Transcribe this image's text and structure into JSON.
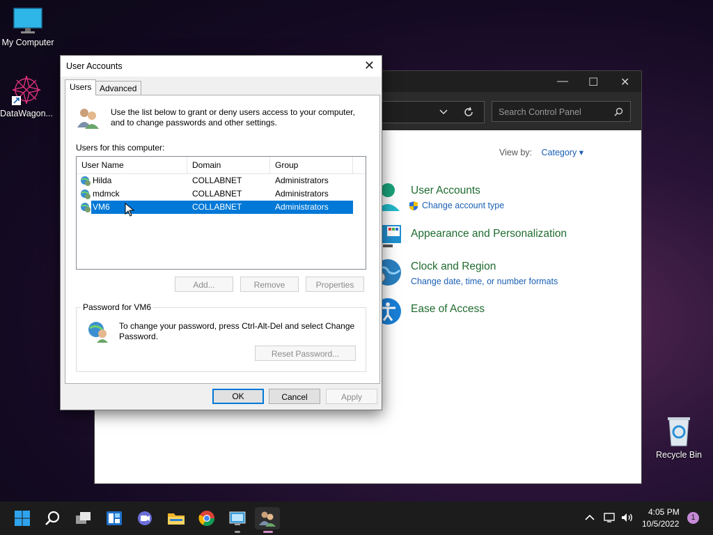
{
  "desktop": {
    "icons": [
      {
        "label": "My Computer"
      },
      {
        "label": "DataWagon..."
      },
      {
        "label": "Recycle Bin"
      }
    ]
  },
  "control_panel": {
    "window_controls": {
      "minimize": "—",
      "maximize": "☐",
      "close": "✕"
    },
    "search_placeholder": "Search Control Panel",
    "view_by_label": "View by:",
    "view_by_value": "Category",
    "categories": [
      {
        "title": "User Accounts",
        "link": "Change account type"
      },
      {
        "title": "Appearance and Personalization",
        "link": ""
      },
      {
        "title": "Clock and Region",
        "link": "Change date, time, or number formats"
      },
      {
        "title": "Ease of Access",
        "link": ""
      }
    ]
  },
  "dialog": {
    "title": "User Accounts",
    "close": "✕",
    "tabs": [
      "Users",
      "Advanced"
    ],
    "intro": "Use the list below to grant or deny users access to your computer, and to change passwords and other settings.",
    "users_label": "Users for this computer:",
    "columns": [
      "User Name",
      "Domain",
      "Group"
    ],
    "rows": [
      {
        "name": "Hilda",
        "domain": "COLLABNET",
        "group": "Administrators"
      },
      {
        "name": "mdmck",
        "domain": "COLLABNET",
        "group": "Administrators"
      },
      {
        "name": "VM6",
        "domain": "COLLABNET",
        "group": "Administrators"
      }
    ],
    "selected_row": 2,
    "list_buttons": {
      "add": "Add...",
      "remove": "Remove",
      "properties": "Properties"
    },
    "password_group_label": "Password for VM6",
    "password_text": "To change your password, press Ctrl-Alt-Del and select Change Password.",
    "reset_button": "Reset Password...",
    "footer": {
      "ok": "OK",
      "cancel": "Cancel",
      "apply": "Apply"
    }
  },
  "taskbar": {
    "time": "4:05 PM",
    "date": "10/5/2022",
    "notification_count": "1"
  },
  "colors": {
    "accent": "#0078d7",
    "cp_category": "#1f6b2f",
    "cp_link": "#1a5fb4"
  }
}
